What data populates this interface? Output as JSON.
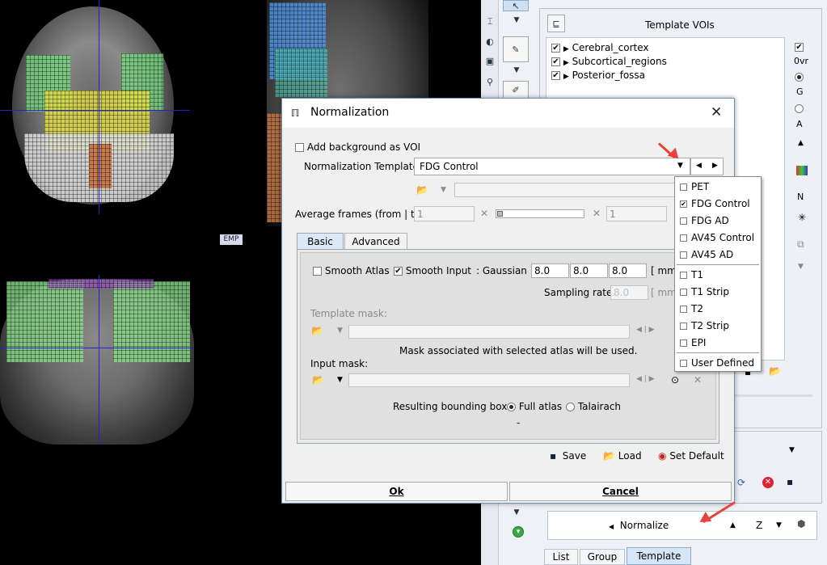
{
  "images": {
    "emp_label": "EMP"
  },
  "right_panel": {
    "title": "Template VOIs",
    "tree": [
      {
        "label": "Cerebral_cortex",
        "checked": true
      },
      {
        "label": "Subcortical_regions",
        "checked": true
      },
      {
        "label": "Posterior_fossa",
        "checked": true
      }
    ],
    "side_options": {
      "opacity": "0vr",
      "g": "G",
      "a": "A",
      "n": "N"
    },
    "normalize_label": "Normalize",
    "z_label": "Z",
    "tabs": [
      "List",
      "Group",
      "Template"
    ],
    "active_tab": "Template"
  },
  "dialog": {
    "title": "Normalization",
    "add_background_label": "Add background as VOI",
    "template_label": "Normalization Template",
    "template_value": "FDG Control",
    "average_frames_label": "Average frames (from | to)",
    "avg_from": "1",
    "avg_to": "1",
    "tabs": {
      "basic": "Basic",
      "advanced": "Advanced"
    },
    "smooth_atlas_label": "Smooth Atlas",
    "smooth_input_label": "Smooth Input",
    "gaussian_label": ": Gaussian",
    "gx": "8.0",
    "gy": "8.0",
    "gz": "8.0",
    "mm_partial": "[ mm",
    "sampling_rate_label": "Sampling rate",
    "sampling_rate_value": "8.0",
    "template_mask_label": "Template mask:",
    "mask_info": "Mask associated with selected atlas will be used.",
    "input_mask_label": "Input mask:",
    "bbox_label": "Resulting bounding box:",
    "bbox_full": "Full atlas",
    "bbox_talairach": "Talairach",
    "dash": "-",
    "save_label": "Save",
    "load_label": "Load",
    "set_default_label": "Set Default",
    "ok_label": "Ok",
    "cancel_label": "Cancel"
  },
  "dropdown": {
    "items": [
      "PET",
      "FDG Control",
      "FDG AD",
      "AV45 Control",
      "AV45 AD",
      "T1",
      "T1 Strip",
      "T2",
      "T2 Strip",
      "EPI",
      "User Defined"
    ],
    "selected": "FDG Control"
  },
  "colors": {
    "accent_arrow": "#e8423a",
    "selection": "#cfe3f7",
    "dialog_border": "#6b8fb5"
  }
}
